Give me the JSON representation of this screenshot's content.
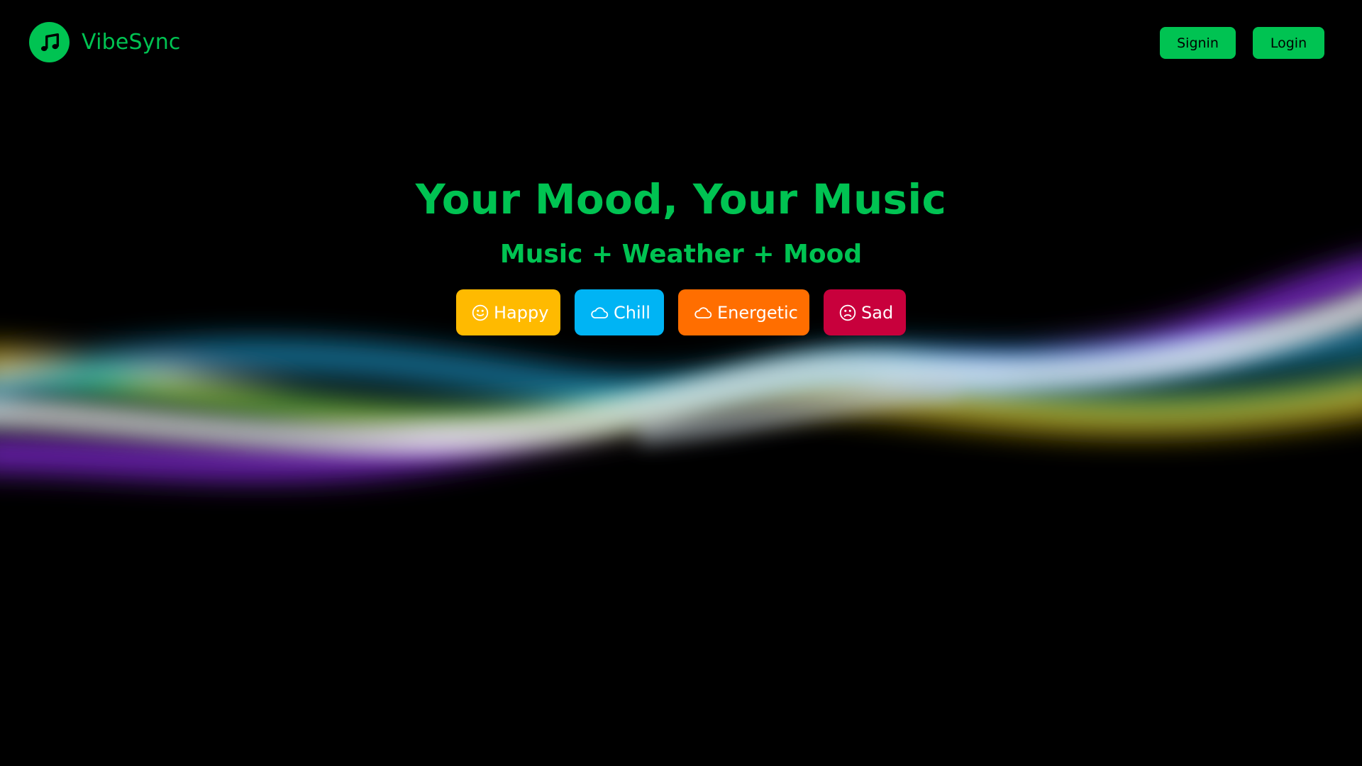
{
  "brand": {
    "name": "VibeSync",
    "logo_icon": "music-note-icon",
    "accent_color": "#00c352"
  },
  "nav": {
    "signin_label": "Signin",
    "login_label": "Login"
  },
  "hero": {
    "title": "Your Mood, Your Music",
    "subtitle": "Music + Weather + Mood"
  },
  "moods": [
    {
      "label": "Happy",
      "icon": "smile-icon",
      "color": "#ffba00"
    },
    {
      "label": "Chill",
      "icon": "cloud-icon",
      "color": "#00b4f4"
    },
    {
      "label": "Energetic",
      "icon": "cloud-icon",
      "color": "#ff6e00"
    },
    {
      "label": "Sad",
      "icon": "frown-icon",
      "color": "#c8003c"
    }
  ],
  "wave_colors": [
    "#ffd400",
    "#2ed573",
    "#22c1ff",
    "#c4c4ff",
    "#9b30ff",
    "#ffffff"
  ]
}
